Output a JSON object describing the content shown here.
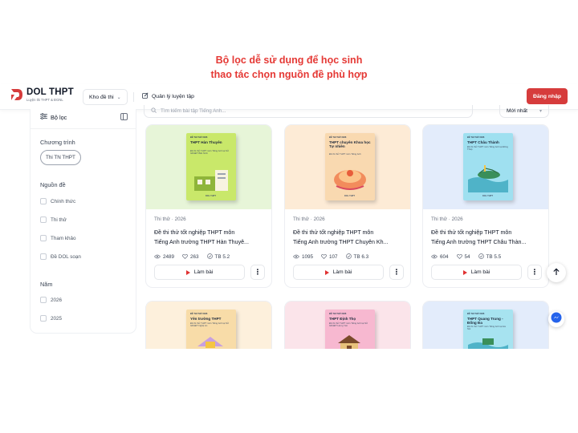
{
  "caption": {
    "line1": "Bộ lọc dễ sử dụng để học sinh",
    "line2": "thao tác chọn nguồn đề phù hợp"
  },
  "header": {
    "logo_title": "DOL THPT",
    "logo_sub": "Luyện thi THPT & ĐGNL",
    "kho_de_thi": "Kho đề thi",
    "quan_ly": "Quản lý luyện tập",
    "login": "Đăng nhập"
  },
  "sidebar": {
    "title": "Bộ lọc",
    "program_label": "Chương trình",
    "program_chip": "Thi TN THPT",
    "source_label": "Nguồn đề",
    "sources": [
      "Chính thức",
      "Thi thử",
      "Tham khảo",
      "Đề DOL soạn"
    ],
    "year_label": "Năm",
    "years": [
      "2026",
      "2025"
    ]
  },
  "search": {
    "placeholder": "Tìm kiếm bài tập Tiếng Anh...",
    "sort": "Mới nhất"
  },
  "cards": [
    {
      "meta_type": "Thi thử",
      "meta_year": "2026",
      "title_l1": "Đề thi thử tốt nghiệp THPT môn",
      "title_l2": "Tiếng Anh trường THPT Hàn Thuyê...",
      "views": "2489",
      "likes": "263",
      "score": "TB 5.2",
      "cta": "Làm bài",
      "book_title": "THPT Hàn Thuyên",
      "book_sub": "Đề thi thử THPT môn Tiếng Anh tại Sở GD&ĐT Bắc Ninh"
    },
    {
      "meta_type": "Thi thử",
      "meta_year": "2026",
      "title_l1": "Đề thi thử tốt nghiệp THPT môn",
      "title_l2": "Tiếng Anh trường THPT Chuyên Kh...",
      "views": "1095",
      "likes": "107",
      "score": "TB 6.3",
      "cta": "Làm bài",
      "book_title": "THPT chuyên Khoa học Tự nhiên",
      "book_sub": "Đề thi thử THPT môn Tiếng Anh"
    },
    {
      "meta_type": "Thi thử",
      "meta_year": "2026",
      "title_l1": "Đề thi thử tốt nghiệp THPT môn",
      "title_l2": "Tiếng Anh trường THPT Châu Thàn...",
      "views": "604",
      "likes": "54",
      "score": "TB 5.5",
      "cta": "Làm bài",
      "book_title": "THPT Châu Thành",
      "book_sub": "Đề thi thử THPT môn Tiếng Anh tại Đồng Tháp"
    },
    {
      "book_title": "Yên trường THPT",
      "book_sub": "Đề thi thử THPT môn Tiếng Anh tại Sở GD&ĐT Nghệ An"
    },
    {
      "book_title": "THPT Định Thọ",
      "book_sub": "Đề thi thử THPT môn Tiếng Anh tại Sở GD&ĐT Hưng Yên"
    },
    {
      "book_title": "THPT Quang Trung - Đống Đa",
      "book_sub": "Đề thi thử THPT môn Tiếng Anh tại Hà Nội"
    }
  ],
  "book_tag": "ĐỀ THI THỬ 2026",
  "book_logo": "DOL THPT",
  "colors": {
    "accent": "#d63c3c",
    "caption": "#e53935",
    "card1_bg": "#e7f5d8",
    "card2_bg": "#fdebd6",
    "card3_bg": "#e3ecfb"
  }
}
